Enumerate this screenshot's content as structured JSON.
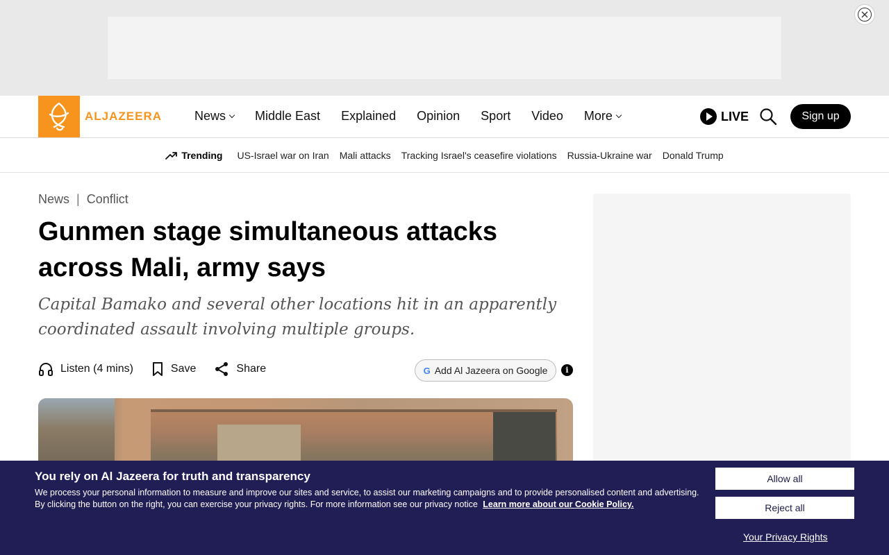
{
  "ad": {
    "close_label": ""
  },
  "brand": {
    "name": "ALJAZEERA"
  },
  "nav": {
    "items": [
      {
        "label": "News",
        "dropdown": true
      },
      {
        "label": "Middle East",
        "dropdown": false
      },
      {
        "label": "Explained",
        "dropdown": false
      },
      {
        "label": "Opinion",
        "dropdown": false
      },
      {
        "label": "Sport",
        "dropdown": false
      },
      {
        "label": "Video",
        "dropdown": false
      },
      {
        "label": "More",
        "dropdown": true
      }
    ],
    "live_label": "LIVE",
    "signup_label": "Sign up"
  },
  "trending": {
    "label": "Trending",
    "links": [
      "US-Israel war on Iran",
      "Mali attacks",
      "Tracking Israel's ceasefire violations",
      "Russia-Ukraine war",
      "Donald Trump"
    ]
  },
  "article": {
    "breadcrumb": {
      "section": "News",
      "separator": "|",
      "category": "Conflict"
    },
    "headline": "Gunmen stage simultaneous attacks across Mali, army says",
    "subheadline": "Capital Bamako and several other locations hit in an apparently coordinated assault involving multiple groups.",
    "actions": {
      "listen": "Listen (4 mins)",
      "save": "Save",
      "share": "Share"
    },
    "google_button": "Add Al Jazeera on Google",
    "info_glyph": "i"
  },
  "cookie": {
    "title": "You rely on Al Jazeera for truth and transparency",
    "text": "We process your personal information to measure and improve our sites and service, to assist our marketing campaigns and to provide personalised content and advertising. By clicking the button on the right, you can exercise your privacy rights. For more information see our privacy notice",
    "link": "Learn more about our Cookie Policy.",
    "allow_label": "Allow all",
    "reject_label": "Reject all",
    "privacy_label": "Your Privacy Rights"
  },
  "colors": {
    "brand_orange": "#f7941d",
    "banner_navy": "#211d55"
  }
}
